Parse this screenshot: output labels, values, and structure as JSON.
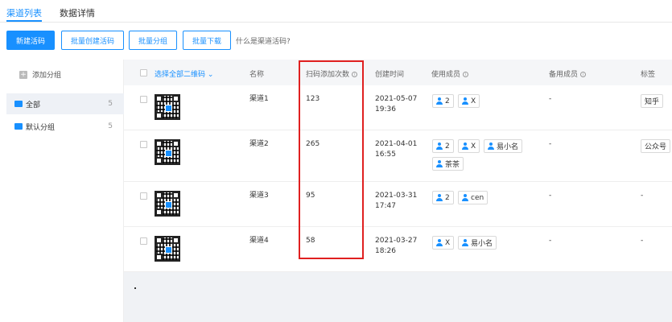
{
  "tabs": [
    {
      "label": "渠道列表"
    },
    {
      "label": "数据详情"
    }
  ],
  "toolbar": {
    "new_code": "新建活码",
    "batch_create": "批量创建活码",
    "batch_group": "批量分组",
    "batch_download": "批量下载",
    "help_link": "什么是渠道活码?"
  },
  "sidebar": {
    "add_group": "添加分组",
    "items": [
      {
        "label": "全部",
        "count": "5"
      },
      {
        "label": "默认分组",
        "count": "5"
      }
    ]
  },
  "table": {
    "headers": {
      "select_all": "选择全部二维码",
      "name": "名称",
      "scan_count": "扫码添加次数",
      "created": "创建时间",
      "members": "使用成员",
      "backup": "备用成员",
      "tags": "标签"
    },
    "rows": [
      {
        "name": "渠道1",
        "scans": "123",
        "date": "2021-05-07",
        "time": "19:36",
        "members": [
          "2",
          "X"
        ],
        "backup": "-",
        "tag": "知乎"
      },
      {
        "name": "渠道2",
        "scans": "265",
        "date": "2021-04-01",
        "time": "16:55",
        "members": [
          "2",
          "X",
          "易小名",
          "茶茶"
        ],
        "backup": "-",
        "tag": "公众号"
      },
      {
        "name": "渠道3",
        "scans": "95",
        "date": "2021-03-31",
        "time": "17:47",
        "members": [
          "2",
          "cen"
        ],
        "backup": "-",
        "tag": "-"
      },
      {
        "name": "渠道4",
        "scans": "58",
        "date": "2021-03-27",
        "time": "18:26",
        "members": [
          "X",
          "易小名"
        ],
        "backup": "-",
        "tag": "-"
      }
    ]
  },
  "colors": {
    "accent": "#1890ff",
    "highlight": "#e02020"
  }
}
